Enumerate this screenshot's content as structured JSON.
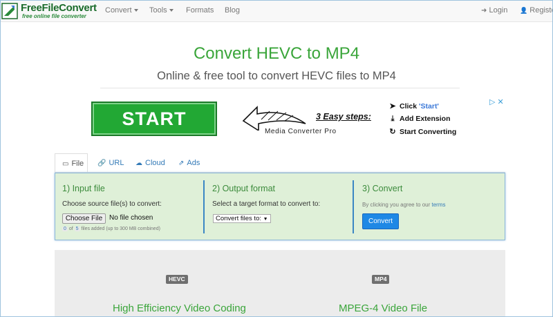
{
  "navbar": {
    "logo_title": "FreeFileConvert",
    "logo_subtitle": "free online file converter",
    "items": [
      {
        "label": "Convert",
        "dropdown": true
      },
      {
        "label": "Tools",
        "dropdown": true
      },
      {
        "label": "Formats",
        "dropdown": false
      },
      {
        "label": "Blog",
        "dropdown": false
      }
    ],
    "login": "Login",
    "register": "Register",
    "login_icon": "sign-in-icon",
    "register_icon": "user-icon"
  },
  "hero": {
    "title": "Convert HEVC to MP4",
    "subtitle": "Online & free tool to convert HEVC files to MP4"
  },
  "ad": {
    "start_label": "START",
    "brand": "Media Converter Pro",
    "steps_title": "3 Easy steps:",
    "step1_prefix": "Click ",
    "step1_highlight": "'Start'",
    "step2": "Add Extension",
    "step3": "Start Converting",
    "adchoices": "▷ ✕"
  },
  "tabs": [
    {
      "label": "File",
      "icon": "monitor-icon",
      "active": true
    },
    {
      "label": "URL",
      "icon": "link-icon",
      "active": false
    },
    {
      "label": "Cloud",
      "icon": "cloud-icon",
      "active": false
    },
    {
      "label": "Ads",
      "icon": "external-link-icon",
      "active": false
    }
  ],
  "panel": {
    "input": {
      "heading": "1) Input file",
      "instruction": "Choose source file(s) to convert:",
      "choose_button": "Choose File",
      "no_file": "No file chosen",
      "count": "0",
      "of_text": "of",
      "max": "5",
      "files_added": "files added (up to 300 MB combined)"
    },
    "output": {
      "heading": "2) Output format",
      "instruction": "Select a target format to convert to:",
      "select_value": "Convert files to:"
    },
    "convert": {
      "heading": "3) Convert",
      "agree_text": "By clicking you agree to our ",
      "terms_link": "terms",
      "button": "Convert"
    }
  },
  "formats": [
    {
      "badge": "HEVC",
      "name": "High Efficiency Video Coding"
    },
    {
      "badge": "MP4",
      "name": "MPEG-4 Video File"
    }
  ],
  "colors": {
    "accent_green": "#3aa53a",
    "panel_bg": "#dff0d8",
    "link_blue": "#337ab7",
    "button_blue": "#1e88e5"
  }
}
